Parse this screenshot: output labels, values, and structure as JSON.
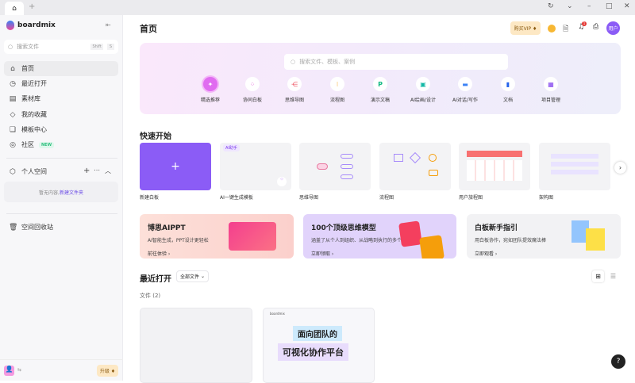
{
  "window": {
    "new_tab": "+"
  },
  "sidebar": {
    "brand": "boardmix",
    "search_placeholder": "搜索文件",
    "shortcut_shift": "Shift",
    "shortcut_key": "S",
    "items": [
      {
        "label": "首页"
      },
      {
        "label": "最近打开"
      },
      {
        "label": "素材库"
      },
      {
        "label": "我的收藏"
      },
      {
        "label": "模板中心"
      },
      {
        "label": "社区",
        "badge": "NEW"
      }
    ],
    "personal_space": "个人空间",
    "empty_text": "暂无内容,",
    "new_folder": "新建文件夹",
    "trash": "空间回收站",
    "upgrade": "升级 ♦"
  },
  "header": {
    "title": "首页",
    "vip": "购买VIP ♦",
    "notif_count": "1",
    "avatar": "用户"
  },
  "hero": {
    "search_placeholder": "搜索文件、模板、案例",
    "categories": [
      {
        "label": "精选推荐"
      },
      {
        "label": "协同白板"
      },
      {
        "label": "思维导图"
      },
      {
        "label": "流程图"
      },
      {
        "label": "演示文稿"
      },
      {
        "label": "AI绘画/设计"
      },
      {
        "label": "AI对话/写作"
      },
      {
        "label": "文档"
      },
      {
        "label": "项目管理"
      }
    ]
  },
  "quick": {
    "title": "快速开始",
    "ai_badge": "AI助手",
    "cards": [
      {
        "label": "新建白板"
      },
      {
        "label": "AI一键生成模板"
      },
      {
        "label": "思维导图"
      },
      {
        "label": "流程图"
      },
      {
        "label": "用户旅程图"
      },
      {
        "label": "架构图"
      }
    ]
  },
  "banners": [
    {
      "title": "博思AIPPT",
      "sub": "AI智能生成，PPT设计更轻松",
      "link": "前往体验"
    },
    {
      "title": "100个顶级思维模型",
      "sub": "涵盖了从个人到组织、从战略到执行的多个领域",
      "link": "立即领取"
    },
    {
      "title": "白板新手指引",
      "sub": "用白板协作，宛如团队提效魔法棒",
      "link": "立即观看"
    }
  ],
  "recent": {
    "title": "最近打开",
    "filter": "全部文件",
    "files_label": "文件 (2)",
    "thumb_line1": "面向团队的",
    "thumb_line2": "可视化协作平台",
    "thumb_brand": "boardmix"
  },
  "help": "?"
}
